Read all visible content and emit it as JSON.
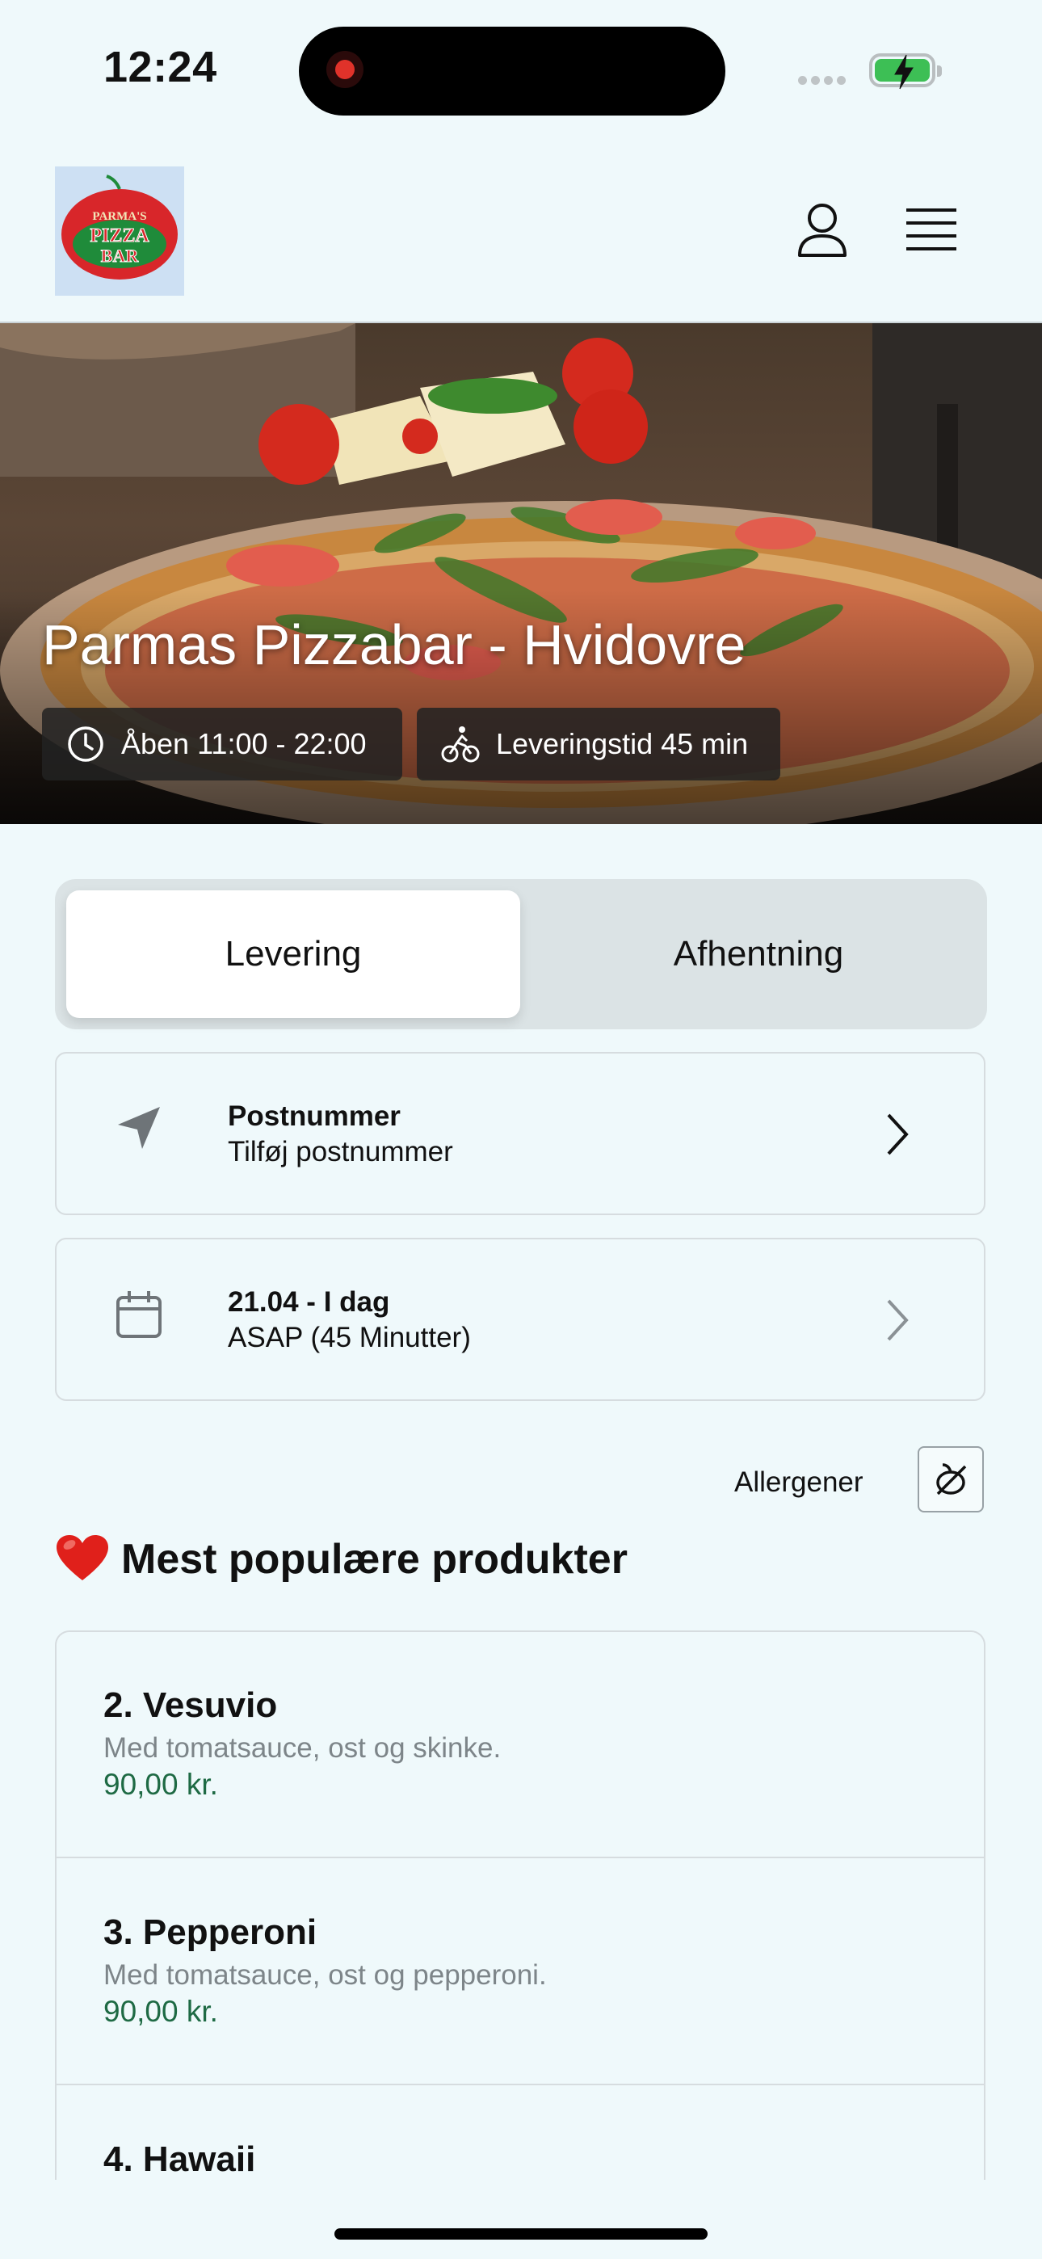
{
  "status_bar": {
    "time": "12:24"
  },
  "header": {
    "logo_text": [
      "PARMA'S",
      "PIZZA",
      "BAR"
    ],
    "icons": [
      "profile-icon",
      "menu-icon"
    ]
  },
  "hero": {
    "title": "Parmas Pizzabar - Hvidovre",
    "opening_hours": "Åben 11:00 - 22:00",
    "delivery_time": "Leveringstid 45 min"
  },
  "order_mode": {
    "options": [
      "Levering",
      "Afhentning"
    ],
    "selected": "Levering"
  },
  "postal": {
    "title": "Postnummer",
    "value": "Tilføj postnummer"
  },
  "schedule": {
    "title": "21.04 - I dag",
    "value": "ASAP (45 Minutter)"
  },
  "allergens": {
    "label": "Allergener"
  },
  "popular": {
    "heading": "Mest populære produkter",
    "products": [
      {
        "name": "2. Vesuvio",
        "description": "Med tomatsauce, ost og skinke.",
        "price": "90,00 kr."
      },
      {
        "name": "3. Pepperoni",
        "description": "Med tomatsauce, ost og pepperoni.",
        "price": "90,00 kr."
      },
      {
        "name": "4. Hawaii",
        "description": "",
        "price": ""
      }
    ]
  },
  "colors": {
    "background": "#eff9fb",
    "price": "#1e6a44",
    "logo_red": "#d8262a",
    "logo_green": "#1f8b3a"
  }
}
